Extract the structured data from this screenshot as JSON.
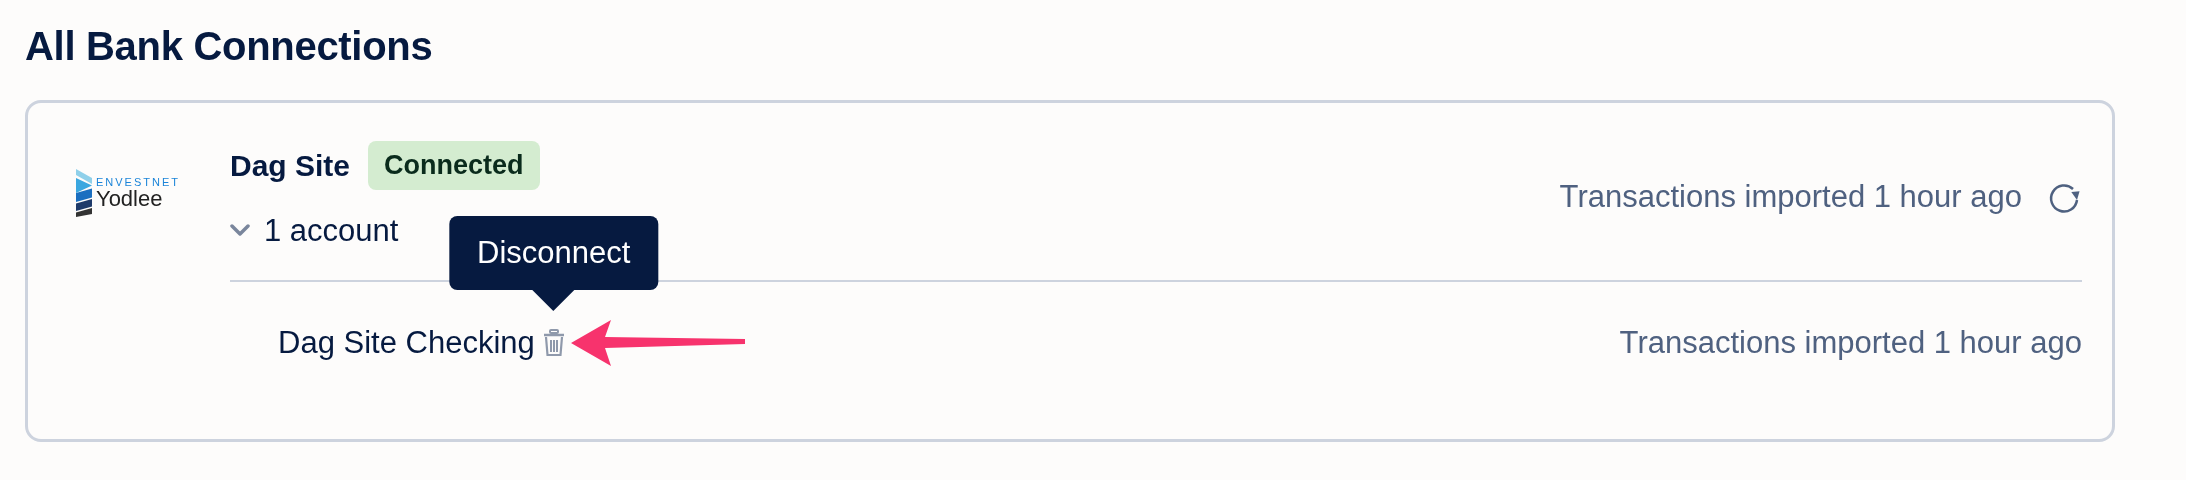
{
  "page_title": "All Bank Connections",
  "connections": [
    {
      "logo": {
        "top": "ENVESTNET",
        "bottom": "Yodlee"
      },
      "name": "Dag Site",
      "status": {
        "kind": "connected",
        "label": "Connected"
      },
      "accounts_toggle": {
        "label": "1 account",
        "expanded": true
      },
      "last_import": "Transactions imported 1 hour ago",
      "accounts": [
        {
          "name": "Dag Site Checking",
          "last_import": "Transactions imported 1 hour ago",
          "tooltip": "Disconnect"
        }
      ]
    }
  ]
}
